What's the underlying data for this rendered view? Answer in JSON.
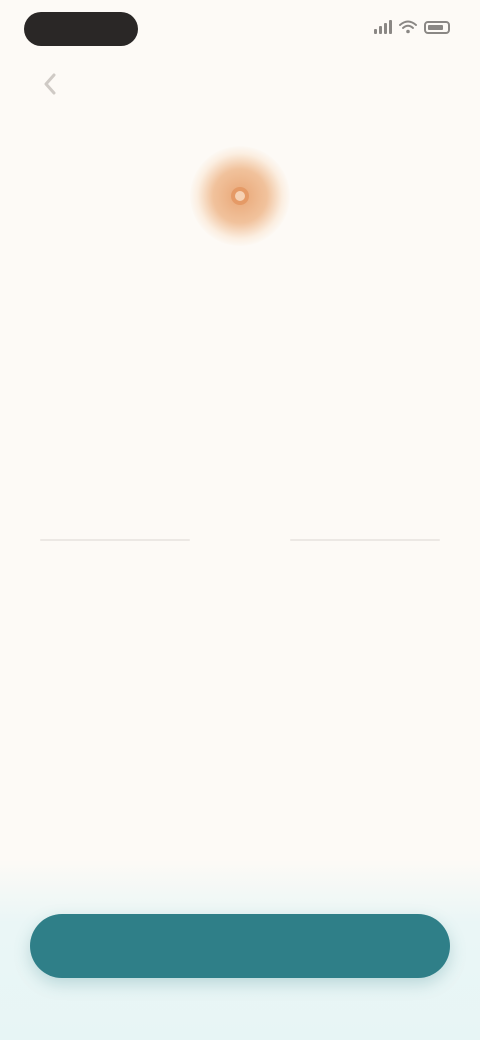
{
  "status_bar": {
    "time": "",
    "icons": [
      "signal-icon",
      "wifi-icon",
      "battery-icon"
    ]
  },
  "navigation": {
    "back_icon": "chevron-left-icon"
  },
  "hero": {
    "icon": "sun-icon",
    "accent_color": "#e9a777"
  },
  "content": {
    "title": "",
    "subtitle": ""
  },
  "picker": {
    "above": [
      "",
      ""
    ],
    "selected": "",
    "below": [
      "",
      ""
    ]
  },
  "cta": {
    "label": "",
    "color": "#2f7f88"
  }
}
